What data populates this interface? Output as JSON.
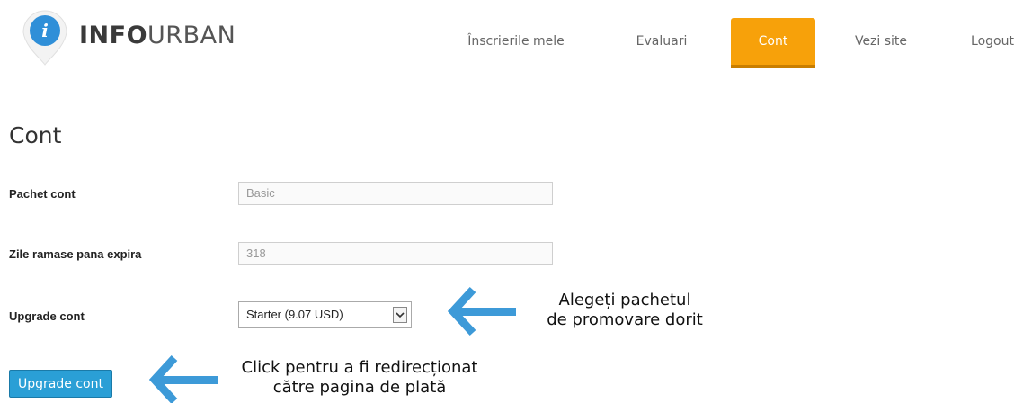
{
  "brand": {
    "name_bold": "INFO",
    "name_light": "URBAN",
    "logo_letter": "i"
  },
  "nav": {
    "items": [
      {
        "label": "Înscrierile mele"
      },
      {
        "label": "Evaluari"
      },
      {
        "label": "Cont"
      },
      {
        "label": "Vezi site"
      },
      {
        "label": "Logout"
      }
    ],
    "active": "Cont"
  },
  "page": {
    "title": "Cont"
  },
  "form": {
    "package": {
      "label": "Pachet cont",
      "value": "Basic"
    },
    "days_left": {
      "label": "Zile ramase pana expira",
      "value": "318"
    },
    "upgrade": {
      "label": "Upgrade cont",
      "selected": "Starter (9.07 USD)"
    },
    "submit_label": "Upgrade cont"
  },
  "annotations": {
    "select_hint": {
      "line1": "Alegeți pachetul",
      "line2": "de promovare dorit"
    },
    "button_hint": {
      "line1": "Click pentru a fi redirecționat",
      "line2": "către pagina de plată"
    }
  },
  "colors": {
    "accent": "#f7a10a",
    "button": "#2a9fd6",
    "arrow": "#3d9ad8",
    "logo": "#2f8fd8"
  },
  "icons": [
    "info-pin-logo-icon",
    "chevron-down-icon",
    "left-arrow-icon"
  ]
}
